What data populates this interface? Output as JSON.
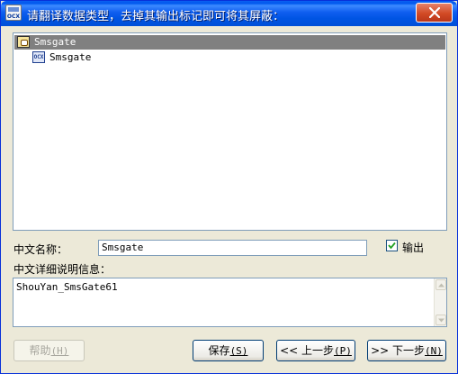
{
  "window": {
    "title": "请翻译数据类型，去掉其输出标记即可将其屏蔽：",
    "icon_text": "OCX"
  },
  "tree": {
    "items": [
      {
        "label": "Smsgate",
        "icon": "database-icon",
        "selected": true
      },
      {
        "label": "Smsgate",
        "icon": "ocx-icon",
        "badge": "OCX"
      }
    ]
  },
  "form": {
    "name_label": "中文名称：",
    "name_value": "Smsgate",
    "output_label": "输出",
    "output_checked": true,
    "desc_label": "中文详细说明信息：",
    "desc_value": "ShouYan_SmsGate61"
  },
  "buttons": {
    "help": {
      "label": "帮助",
      "key": "(H)",
      "enabled": false
    },
    "save": {
      "label": "保存",
      "key": "(S)"
    },
    "prev": {
      "label": "<< 上一步",
      "key": "(P)"
    },
    "next": {
      "label": ">> 下一步",
      "key": "(N)"
    }
  },
  "colors": {
    "titlebar": "#0054e3",
    "selection": "#808080",
    "face": "#ece9d8"
  }
}
